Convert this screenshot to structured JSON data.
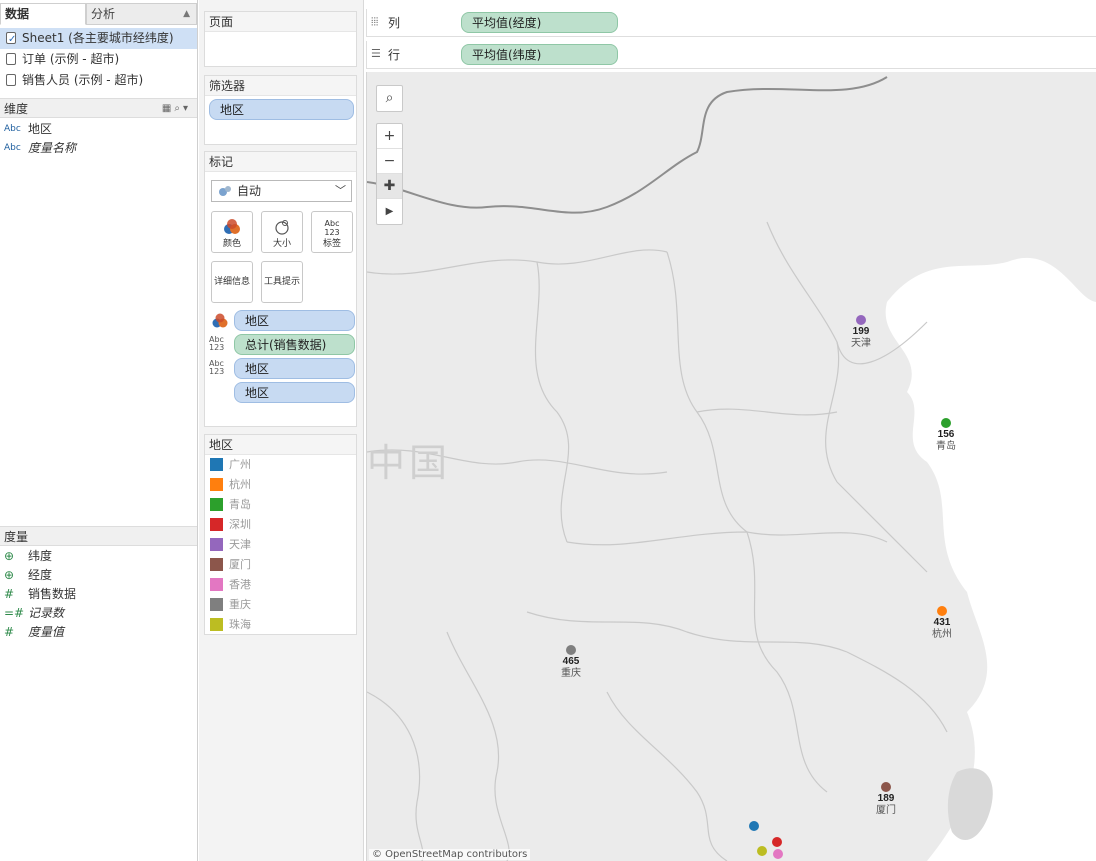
{
  "left_pane": {
    "tabs": [
      {
        "label": "数据"
      },
      {
        "label": "分析"
      }
    ],
    "data_sources": [
      {
        "label": "Sheet1 (各主要城市经纬度)"
      },
      {
        "label": "订单 (示例 - 超市)"
      },
      {
        "label": "销售人员 (示例 - 超市)"
      }
    ],
    "dimensions_header": "维度",
    "dimensions": [
      {
        "type": "Abc",
        "label": "地区"
      },
      {
        "type": "Abc",
        "label": "度量名称"
      }
    ],
    "measures_header": "度量",
    "measures": [
      {
        "icon": "globe-icon",
        "label": "纬度"
      },
      {
        "icon": "globe-icon",
        "label": "经度"
      },
      {
        "icon": "hash-icon",
        "label": "销售数据"
      },
      {
        "icon": "hash-icon",
        "label": "记录数"
      },
      {
        "icon": "hash-icon",
        "label": "度量值"
      }
    ]
  },
  "pages_card": {
    "title": "页面"
  },
  "filters_card": {
    "title": "筛选器",
    "pill": "地区"
  },
  "marks_card": {
    "title": "标记",
    "mark_type": "自动",
    "buttons": [
      {
        "label": "颜色",
        "icon": "color-icon"
      },
      {
        "label": "大小",
        "icon": "size-icon"
      },
      {
        "label": "标签",
        "icon": "label-icon"
      },
      {
        "label": "详细信息",
        "icon": "detail-icon"
      },
      {
        "label": "工具提示",
        "icon": "tooltip-icon"
      }
    ],
    "encodings": [
      {
        "icon": "color-icon",
        "pill": "地区",
        "kind": "dimension"
      },
      {
        "icon": "label-icon",
        "pill": "总计(销售数据)",
        "kind": "measure"
      },
      {
        "icon": "label-icon",
        "pill": "地区",
        "kind": "dimension"
      },
      {
        "icon": "",
        "pill": "地区",
        "kind": "dimension"
      }
    ]
  },
  "legend": {
    "title": "地区",
    "items": [
      {
        "label": "广州",
        "color": "#1f77b4"
      },
      {
        "label": "杭州",
        "color": "#ff7f0e"
      },
      {
        "label": "青岛",
        "color": "#2ca02c"
      },
      {
        "label": "深圳",
        "color": "#d62728"
      },
      {
        "label": "天津",
        "color": "#9467bd"
      },
      {
        "label": "厦门",
        "color": "#8c564b"
      },
      {
        "label": "香港",
        "color": "#e377c2"
      },
      {
        "label": "重庆",
        "color": "#7f7f7f"
      },
      {
        "label": "珠海",
        "color": "#bcbd22"
      }
    ]
  },
  "shelves": {
    "columns": {
      "label": "列",
      "pill": "平均值(经度)"
    },
    "rows": {
      "label": "行",
      "pill": "平均值(纬度)"
    }
  },
  "map": {
    "watermark": "中国",
    "attribution": "© OpenStreetMap contributors",
    "controls": [
      "search-icon",
      "zoom-in-icon",
      "zoom-out-icon",
      "pin-icon",
      "play-icon"
    ]
  },
  "chart_data": {
    "type": "scatter",
    "title": "",
    "xlabel": "平均值(经度)",
    "ylabel": "平均值(纬度)",
    "points": [
      {
        "city": "天津",
        "value": 199,
        "color": "#9467bd",
        "labeled": true
      },
      {
        "city": "青岛",
        "value": 156,
        "color": "#2ca02c",
        "labeled": true
      },
      {
        "city": "杭州",
        "value": 431,
        "color": "#ff7f0e",
        "labeled": true
      },
      {
        "city": "重庆",
        "value": 465,
        "color": "#7f7f7f",
        "labeled": true
      },
      {
        "city": "厦门",
        "value": 189,
        "color": "#8c564b",
        "labeled": true
      },
      {
        "city": "广州",
        "color": "#1f77b4",
        "labeled": false
      },
      {
        "city": "深圳",
        "color": "#d62728",
        "labeled": false
      },
      {
        "city": "珠海",
        "color": "#bcbd22",
        "labeled": false
      },
      {
        "city": "香港",
        "color": "#e377c2",
        "labeled": false
      }
    ]
  }
}
